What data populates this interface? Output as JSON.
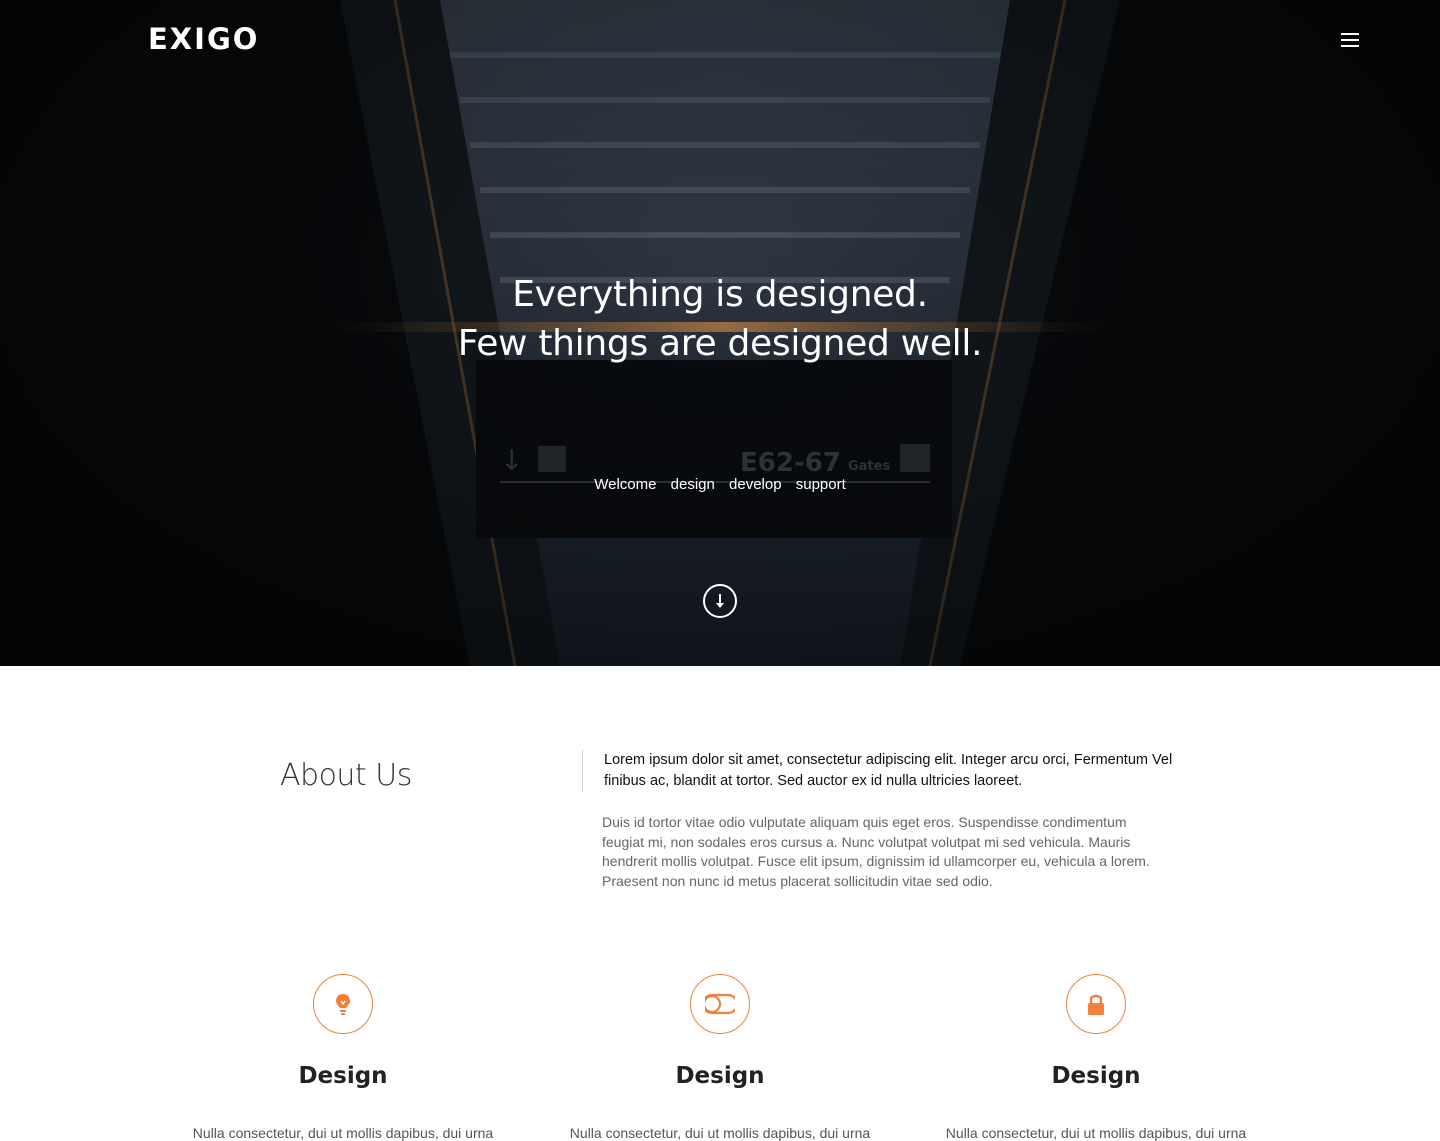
{
  "header": {
    "logo": "EXIGO",
    "menu_icon": "hamburger-menu-icon"
  },
  "hero": {
    "headline_line1": "Everything is designed.",
    "headline_line2": "Few things are designed well.",
    "tagline": [
      "Welcome",
      "design",
      "develop",
      "support"
    ],
    "scroll_icon": "arrow-down-circle-icon"
  },
  "about": {
    "title": "About Us",
    "lead": "Lorem ipsum dolor sit amet, consectetur adipiscing elit. Integer arcu orci, Fermentum Vel finibus ac, blandit at tortor. Sed auctor ex id nulla ultricies laoreet.",
    "body": "Duis id tortor vitae odio vulputate aliquam quis eget eros. Suspendisse condimentum feugiat mi, non sodales eros cursus a. Nunc volutpat volutpat mi sed vehicula. Mauris hendrerit mollis volutpat. Fusce elit ipsum, dignissim id ullamcorper eu, vehicula a lorem. Praesent non nunc id metus placerat sollicitudin vitae sed odio."
  },
  "features": [
    {
      "icon": "lightbulb-icon",
      "title": "Design",
      "text": "Nulla consectetur, dui ut mollis dapibus, dui urna"
    },
    {
      "icon": "toggle-icon",
      "title": "Design",
      "text": "Nulla consectetur, dui ut mollis dapibus, dui urna"
    },
    {
      "icon": "lock-icon",
      "title": "Design",
      "text": "Nulla consectetur, dui ut mollis dapibus, dui urna"
    }
  ],
  "colors": {
    "accent": "#f0803c",
    "hero_bg": "#07090c"
  }
}
